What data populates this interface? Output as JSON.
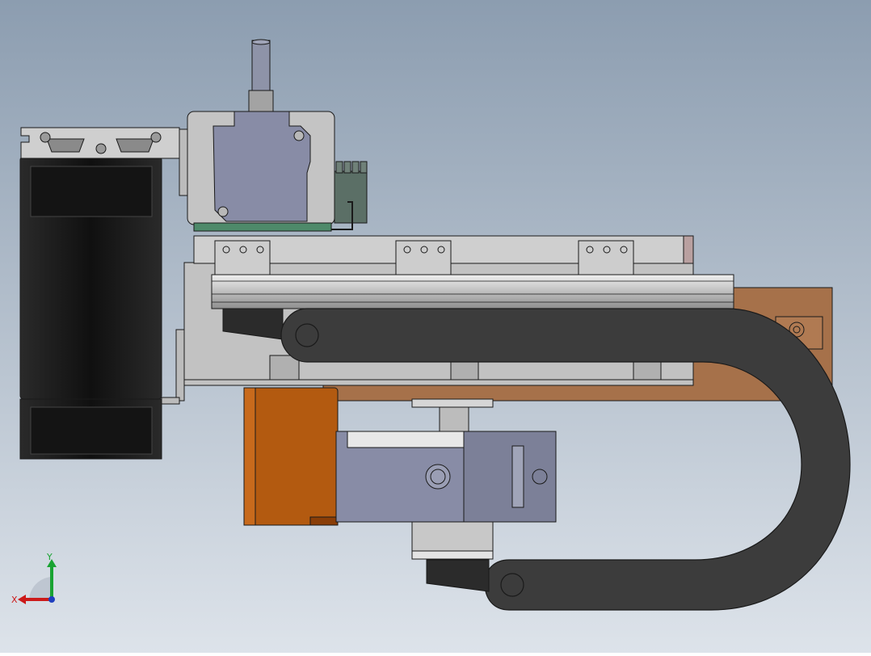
{
  "viewport": {
    "background_top": "#8c9db0",
    "background_bottom": "#dde3ea"
  },
  "colors": {
    "outline": "#1a1a1a",
    "aluminum": "#c2c2c2",
    "aluminum_light": "#dcdcdc",
    "aluminum_dark": "#9a9a9a",
    "black_part": "#1e1e1e",
    "drag_chain": "#3c3c3c",
    "motor_body": "#8a8ea6",
    "motor_dark": "#6f738a",
    "orange_part": "#b35a10",
    "copper_plate": "#a6714a",
    "green_pcb": "#4e8a6a"
  },
  "triad": {
    "x_label": "X",
    "y_label": "Y",
    "x_color": "#cc1a1a",
    "y_color": "#19a332",
    "z_color": "#1f3fbf"
  }
}
